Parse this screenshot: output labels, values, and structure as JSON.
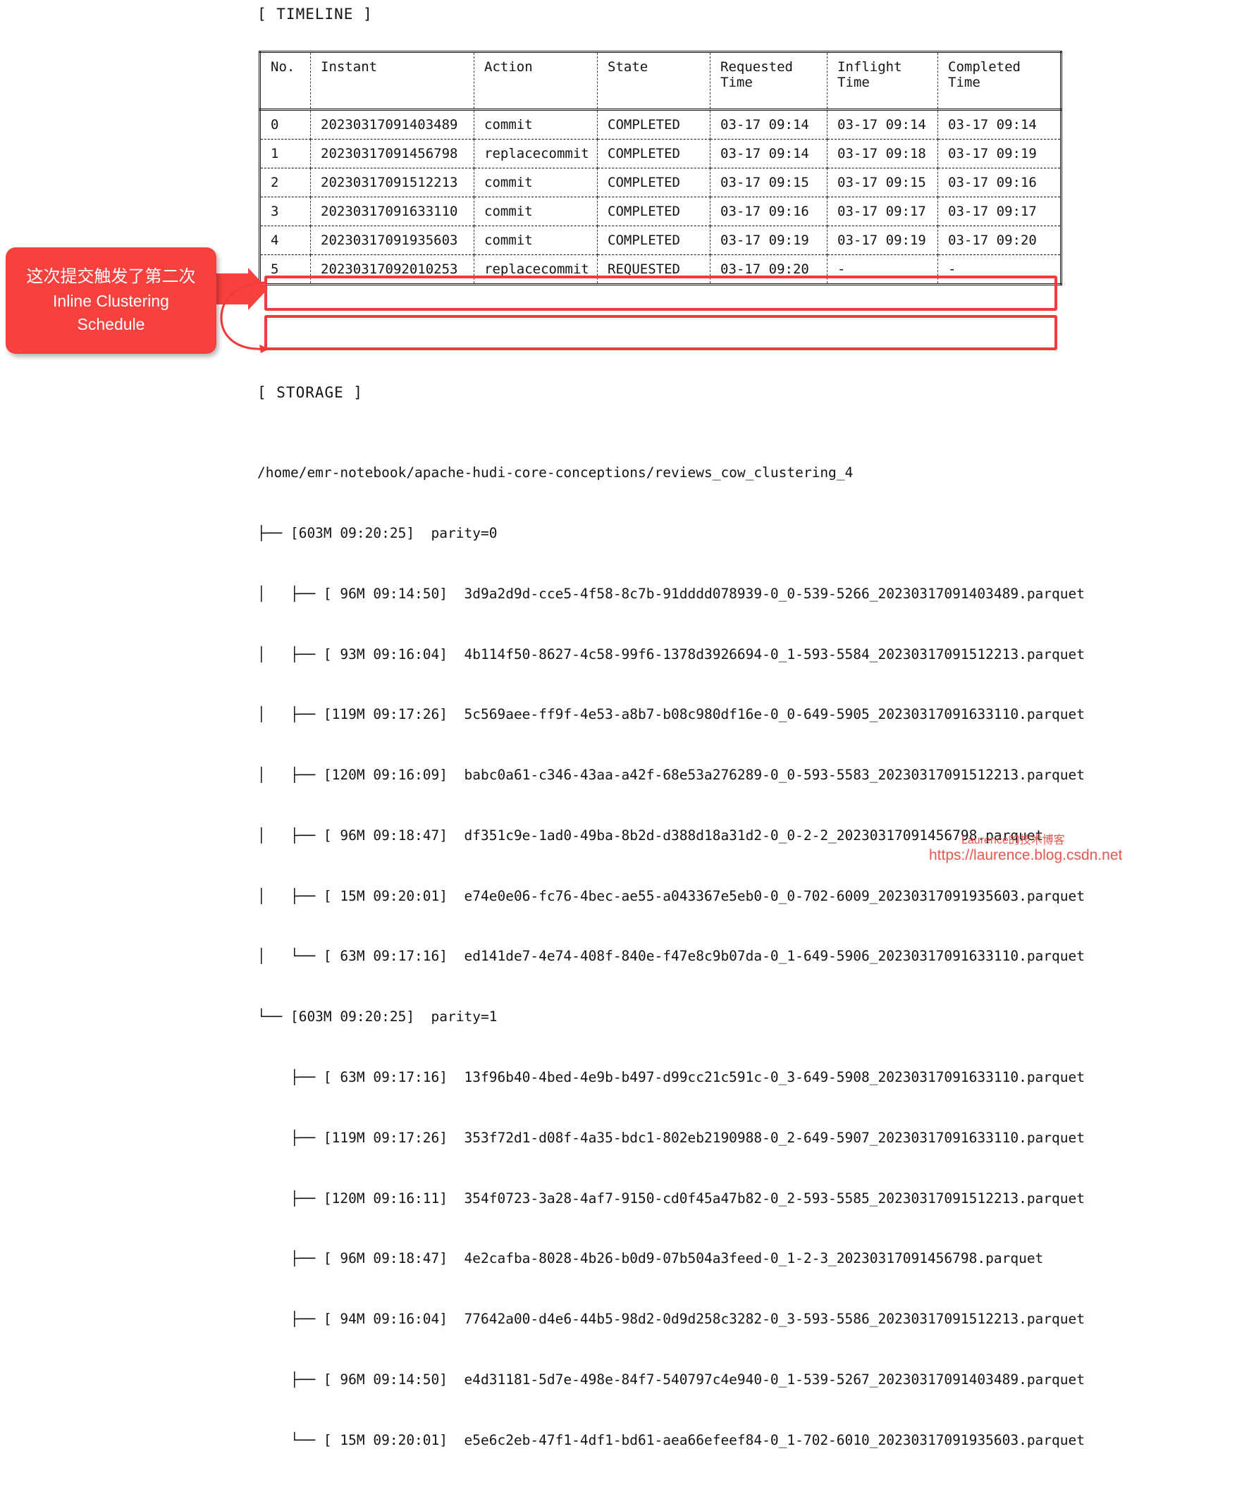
{
  "timeline": {
    "label": "[ TIMELINE ]",
    "columns": [
      "No.",
      "Instant",
      "Action",
      "State",
      "Requested\nTime",
      "Inflight\nTime",
      "Completed\nTime"
    ],
    "rows": [
      {
        "no": "0",
        "instant": "20230317091403489",
        "action": "commit",
        "state": "COMPLETED",
        "requested": "03-17 09:14",
        "inflight": "03-17 09:14",
        "completed": "03-17 09:14"
      },
      {
        "no": "1",
        "instant": "20230317091456798",
        "action": "replacecommit",
        "state": "COMPLETED",
        "requested": "03-17 09:14",
        "inflight": "03-17 09:18",
        "completed": "03-17 09:19"
      },
      {
        "no": "2",
        "instant": "20230317091512213",
        "action": "commit",
        "state": "COMPLETED",
        "requested": "03-17 09:15",
        "inflight": "03-17 09:15",
        "completed": "03-17 09:16"
      },
      {
        "no": "3",
        "instant": "20230317091633110",
        "action": "commit",
        "state": "COMPLETED",
        "requested": "03-17 09:16",
        "inflight": "03-17 09:17",
        "completed": "03-17 09:17"
      },
      {
        "no": "4",
        "instant": "20230317091935603",
        "action": "commit",
        "state": "COMPLETED",
        "requested": "03-17 09:19",
        "inflight": "03-17 09:19",
        "completed": "03-17 09:20"
      },
      {
        "no": "5",
        "instant": "20230317092010253",
        "action": "replacecommit",
        "state": "REQUESTED",
        "requested": "03-17 09:20",
        "inflight": "-",
        "completed": "-"
      }
    ]
  },
  "callout": {
    "line1": "这次提交触发了第二次",
    "line2": "Inline Clustering",
    "line3": "Schedule",
    "color": "#f7413f"
  },
  "storage": {
    "label": "[ STORAGE ]",
    "root": "/home/emr-notebook/apache-hudi-core-conceptions/reviews_cow_clustering_4",
    "lines": [
      "├── [603M 09:20:25]  parity=0",
      "│   ├── [ 96M 09:14:50]  3d9a2d9d-cce5-4f58-8c7b-91dddd078939-0_0-539-5266_20230317091403489.parquet",
      "│   ├── [ 93M 09:16:04]  4b114f50-8627-4c58-99f6-1378d3926694-0_1-593-5584_20230317091512213.parquet",
      "│   ├── [119M 09:17:26]  5c569aee-ff9f-4e53-a8b7-b08c980df16e-0_0-649-5905_20230317091633110.parquet",
      "│   ├── [120M 09:16:09]  babc0a61-c346-43aa-a42f-68e53a276289-0_0-593-5583_20230317091512213.parquet",
      "│   ├── [ 96M 09:18:47]  df351c9e-1ad0-49ba-8b2d-d388d18a31d2-0_0-2-2_20230317091456798.parquet",
      "│   ├── [ 15M 09:20:01]  e74e0e06-fc76-4bec-ae55-a043367e5eb0-0_0-702-6009_20230317091935603.parquet",
      "│   └── [ 63M 09:17:16]  ed141de7-4e74-408f-840e-f47e8c9b07da-0_1-649-5906_20230317091633110.parquet",
      "└── [603M 09:20:25]  parity=1",
      "    ├── [ 63M 09:17:16]  13f96b40-4bed-4e9b-b497-d99cc21c591c-0_3-649-5908_20230317091633110.parquet",
      "    ├── [119M 09:17:26]  353f72d1-d08f-4a35-bdc1-802eb2190988-0_2-649-5907_20230317091633110.parquet",
      "    ├── [120M 09:16:11]  354f0723-3a28-4af7-9150-cd0f45a47b82-0_2-593-5585_20230317091512213.parquet",
      "    ├── [ 96M 09:18:47]  4e2cafba-8028-4b26-b0d9-07b504a3feed-0_1-2-3_20230317091456798.parquet",
      "    ├── [ 94M 09:16:04]  77642a00-d4e6-44b5-98d2-0d9d258c3282-0_3-593-5586_20230317091512213.parquet",
      "    ├── [ 96M 09:14:50]  e4d31181-5d7e-498e-84f7-540797c4e940-0_1-539-5267_20230317091403489.parquet",
      "    └── [ 15M 09:20:01]  e5e6c2eb-47f1-4df1-bd61-aea66efeef84-0_1-702-6010_20230317091935603.parquet"
    ]
  },
  "watermark": {
    "cn": "Laurence的技术博客",
    "url": "https://laurence.blog.csdn.net"
  }
}
